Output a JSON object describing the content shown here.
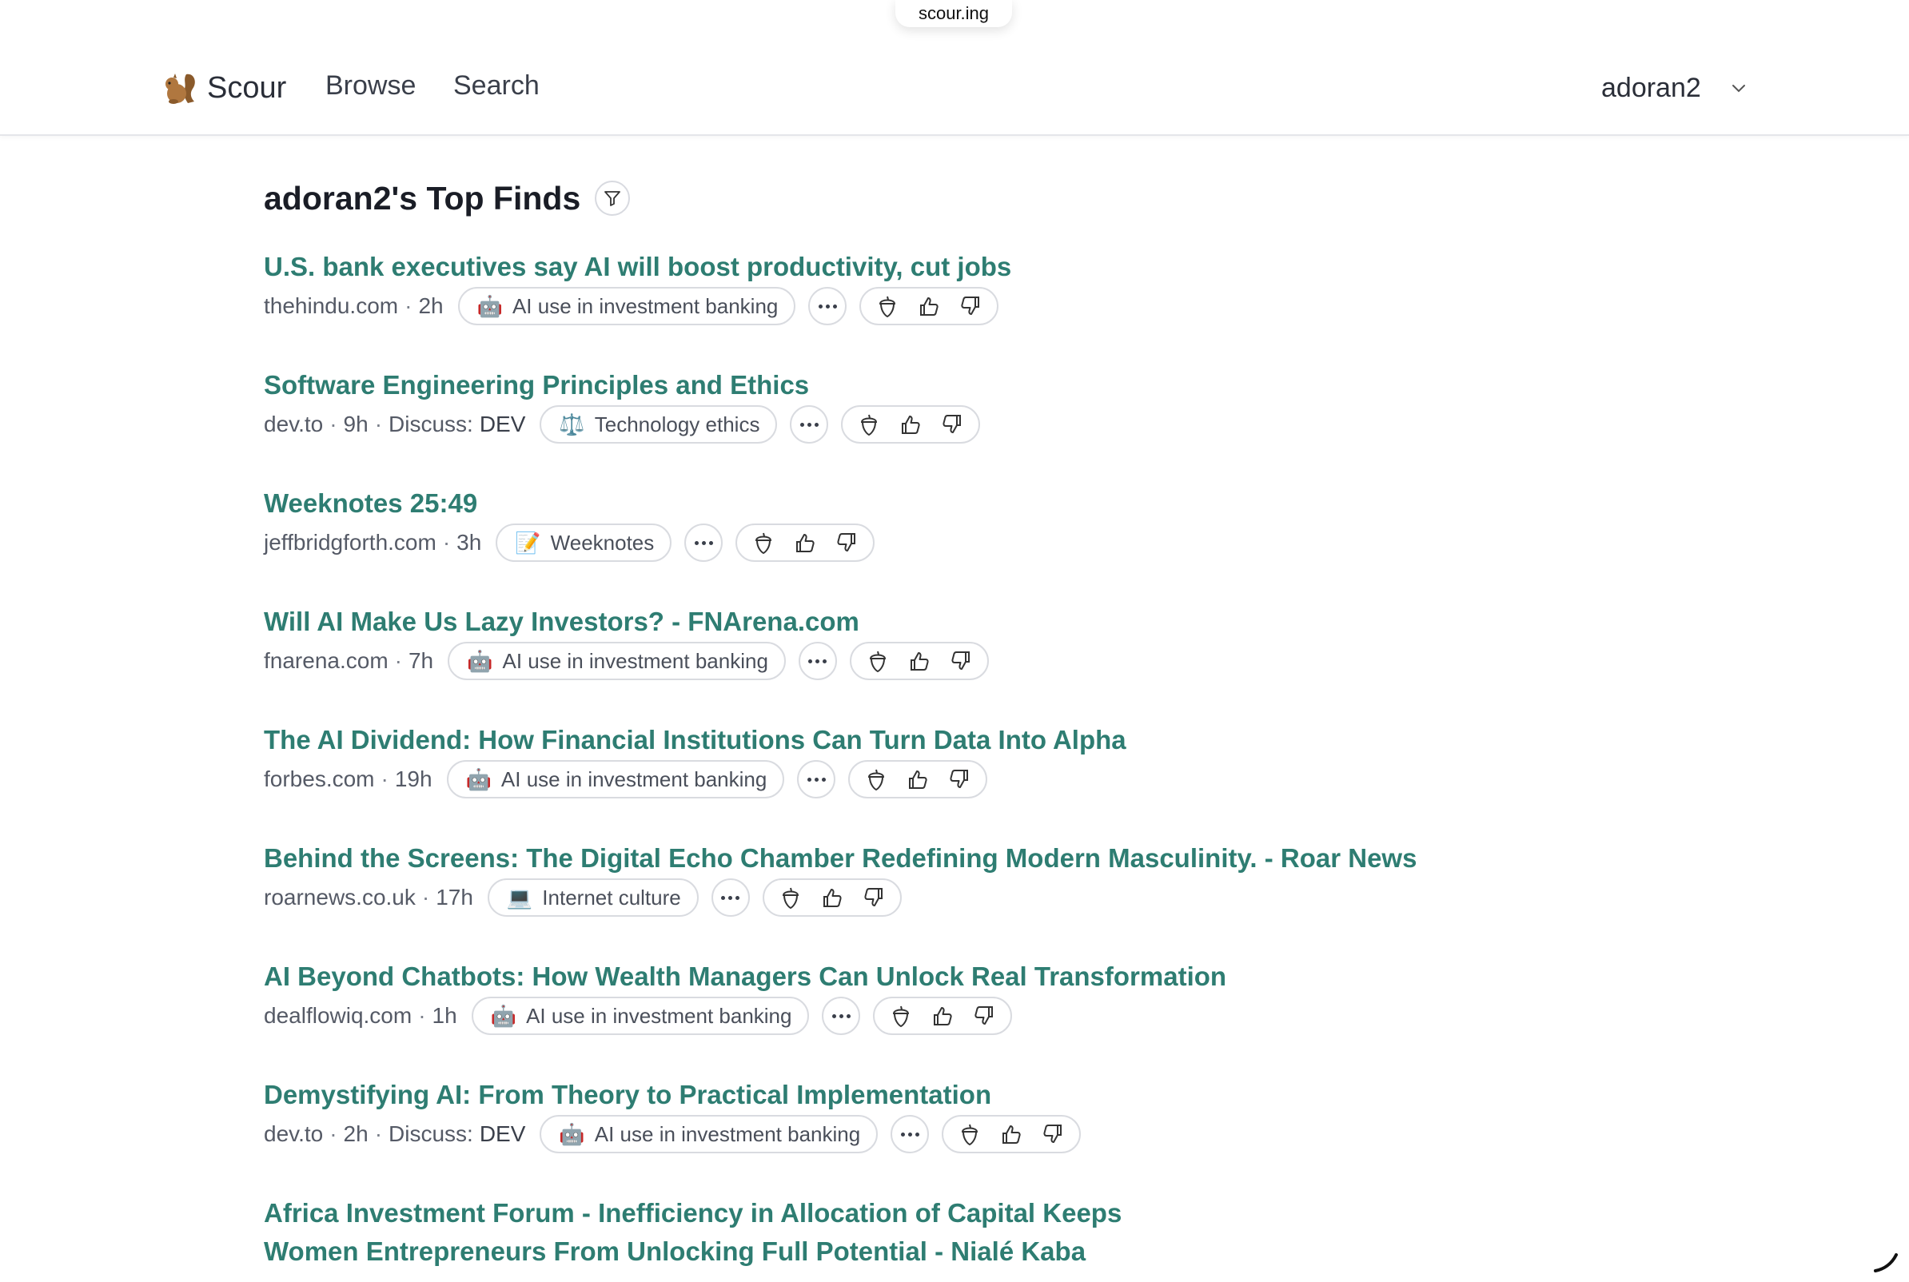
{
  "browser": {
    "url_label": "scour.ing"
  },
  "header": {
    "brand": "Scour",
    "nav": [
      {
        "label": "Browse"
      },
      {
        "label": "Search"
      }
    ],
    "username": "adoran2"
  },
  "page": {
    "title": "adoran2's Top Finds"
  },
  "items": [
    {
      "title": "U.S. bank executives say AI will boost productivity, cut jobs",
      "domain": "thehindu.com",
      "age": "2h",
      "discuss_prefix": "",
      "discuss": "",
      "topic_emoji": "🤖",
      "topic": "AI use in investment banking"
    },
    {
      "title": "Software Engineering Principles and Ethics",
      "domain": "dev.to",
      "age": "9h",
      "discuss_prefix": "Discuss:",
      "discuss": "DEV",
      "topic_emoji": "⚖️",
      "topic": "Technology ethics"
    },
    {
      "title": "Weeknotes 25:49",
      "domain": "jeffbridgforth.com",
      "age": "3h",
      "discuss_prefix": "",
      "discuss": "",
      "topic_emoji": "📝",
      "topic": "Weeknotes"
    },
    {
      "title": "Will AI Make Us Lazy Investors? - FNArena.com",
      "domain": "fnarena.com",
      "age": "7h",
      "discuss_prefix": "",
      "discuss": "",
      "topic_emoji": "🤖",
      "topic": "AI use in investment banking"
    },
    {
      "title": "The AI Dividend: How Financial Institutions Can Turn Data Into Alpha",
      "domain": "forbes.com",
      "age": "19h",
      "discuss_prefix": "",
      "discuss": "",
      "topic_emoji": "🤖",
      "topic": "AI use in investment banking"
    },
    {
      "title": "Behind the Screens: The Digital Echo Chamber Redefining Modern Masculinity. - Roar News",
      "domain": "roarnews.co.uk",
      "age": "17h",
      "discuss_prefix": "",
      "discuss": "",
      "topic_emoji": "💻",
      "topic": "Internet culture"
    },
    {
      "title": "AI Beyond Chatbots: How Wealth Managers Can Unlock Real Transformation",
      "domain": "dealflowiq.com",
      "age": "1h",
      "discuss_prefix": "",
      "discuss": "",
      "topic_emoji": "🤖",
      "topic": "AI use in investment banking"
    },
    {
      "title": "Demystifying AI: From Theory to Practical Implementation",
      "domain": "dev.to",
      "age": "2h",
      "discuss_prefix": "Discuss:",
      "discuss": "DEV",
      "topic_emoji": "🤖",
      "topic": "AI use in investment banking"
    },
    {
      "title_line1": "Africa Investment Forum - Inefficiency in Allocation of Capital Keeps",
      "title_line2": "Women Entrepreneurs From Unlocking Full Potential - Nialé Kaba"
    }
  ],
  "colors": {
    "link": "#2e7d72",
    "border": "#d9dbe0",
    "muted": "#555a66"
  },
  "icons": {
    "brand": "squirrel-icon",
    "filter": "filter-icon",
    "more": "more-horizontal-icon",
    "acorn": "acorn-icon",
    "like": "thumbs-up-icon",
    "dislike": "thumbs-down-icon",
    "user_menu": "chevron-down-icon"
  }
}
